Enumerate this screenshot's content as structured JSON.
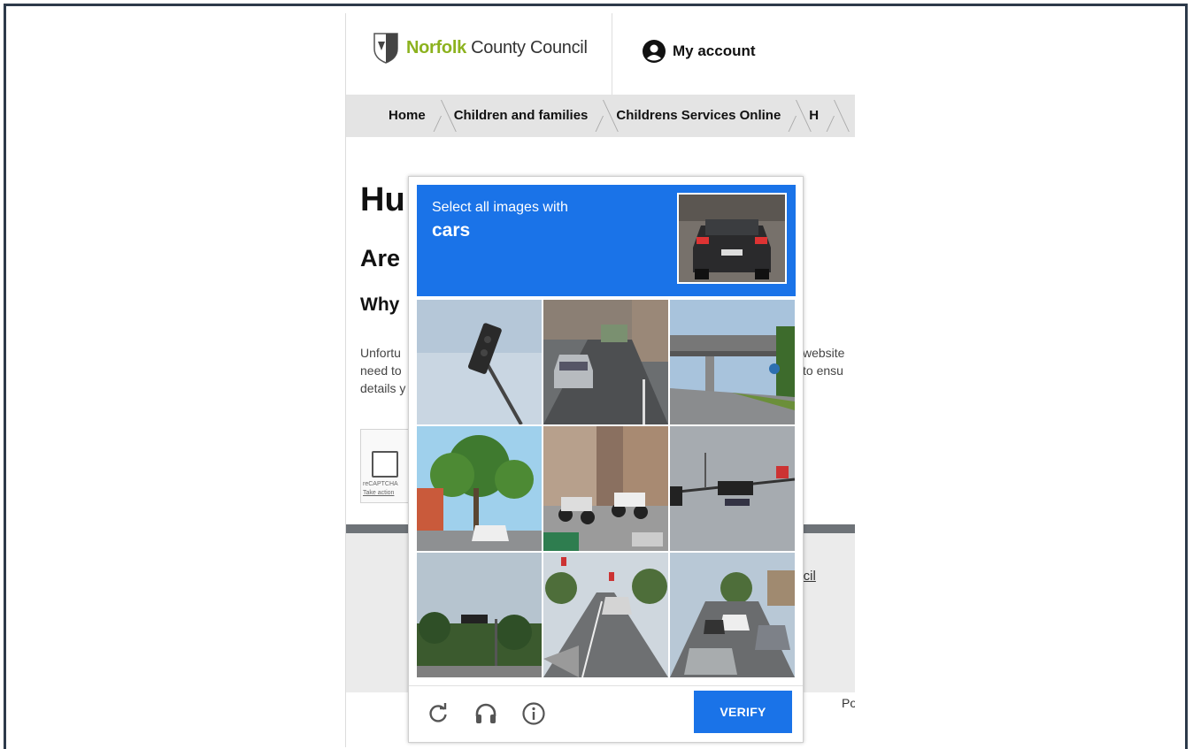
{
  "header": {
    "logo_brand": "Norfolk",
    "logo_rest": " County Council",
    "account_label": "My account"
  },
  "breadcrumb": [
    "Home",
    "Children and families",
    "Childrens Services Online",
    "H"
  ],
  "page": {
    "h1": "Hu",
    "h2": "Are",
    "h3": "Why",
    "para_left": [
      "Unfortu",
      "need to",
      "details y"
    ],
    "para_right": [
      "website",
      "to ensu"
    ],
    "recaptcha_label": "reCAPTCHA",
    "recaptcha_link": "Take action",
    "footer_link": "uncil",
    "footer_po": "Po"
  },
  "captcha": {
    "prompt": "Select all images with",
    "target": "cars",
    "verify_label": "VERIFY",
    "tiles": [
      "traffic light",
      "road with cars",
      "bridge over road",
      "trees and street",
      "parked scooters",
      "traffic light",
      "trees and traffic light",
      "road with car",
      "street with cars"
    ]
  },
  "colors": {
    "accent": "#1a73e8",
    "brand_green": "#8cb21e",
    "frame_border": "#2d3a4a"
  },
  "icons": [
    "shield-logo-icon",
    "account-icon",
    "reload-icon",
    "audio-icon",
    "info-icon"
  ]
}
